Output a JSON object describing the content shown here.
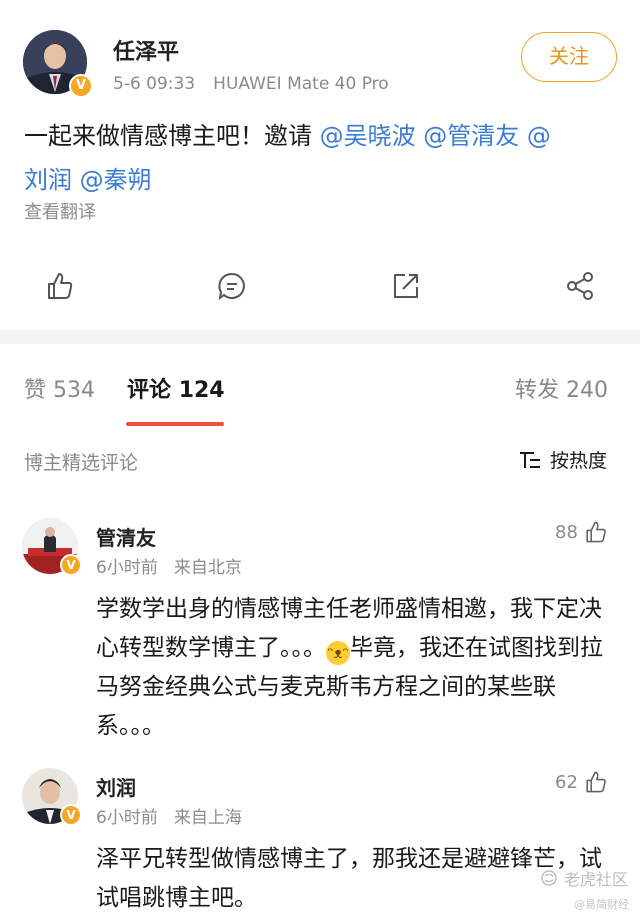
{
  "post": {
    "author": "任泽平",
    "time": "5-6 09:33",
    "device": "HUAWEI Mate 40 Pro",
    "follow_label": "关注",
    "text_prefix": "一起来做情感博主吧！邀请 ",
    "mentions": [
      "@吴晓波",
      "@管清友",
      "@",
      "刘润",
      "@秦朔"
    ],
    "translate_label": "查看翻译",
    "actions": [
      "like-icon",
      "comment-icon",
      "share-icon",
      "more-share-icon"
    ]
  },
  "tabs": {
    "likes_label": "赞",
    "likes_count": "534",
    "comments_label": "评论",
    "comments_count": "124",
    "reposts_label": "转发",
    "reposts_count": "240"
  },
  "filter": {
    "label": "博主精选评论",
    "sort_label": "按热度"
  },
  "comments": [
    {
      "name": "管清友",
      "time": "6小时前",
      "location": "来自北京",
      "likes": "88",
      "text_before": "学数学出身的情感博主任老师盛情相邀，我下定决心转型数学博主了。。。",
      "text_after": "毕竟，我还在试图找到拉马努金经典公式与麦克斯韦方程之间的某些联系。。。"
    },
    {
      "name": "刘润",
      "time": "6小时前",
      "location": "来自上海",
      "likes": "62",
      "text": "泽平兄转型做情感博主了，那我还是避避锋芒，试试唱跳博主吧。"
    }
  ],
  "watermark": {
    "text": "老虎社区",
    "sub": "@易简财经"
  },
  "colors": {
    "accent": "#e8533a",
    "mention": "#3a7bd5",
    "follow": "#e8951a",
    "badge": "#f5a623"
  }
}
